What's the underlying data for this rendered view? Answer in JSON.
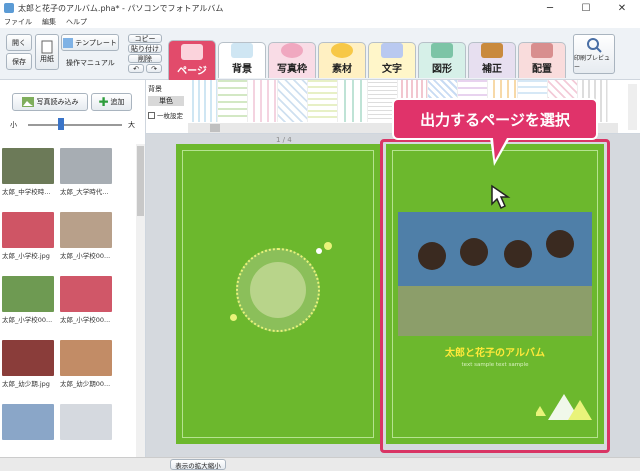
{
  "window": {
    "title": "太郎と花子のアルバム.pha* - パソコンでフォトアルバム",
    "minimize": "─",
    "maximize": "☐",
    "close": "✕"
  },
  "menu": [
    "ファイル",
    "編集",
    "ヘルプ"
  ],
  "toolbar": {
    "open": "開く",
    "save": "保存",
    "paper": "用紙",
    "template": "テンプレート",
    "manual": "操作マニュアル",
    "copy": "コピー",
    "paste": "貼り付け",
    "delete": "削除",
    "undo": "↶",
    "redo": "↷",
    "print_preview": "印刷プレビュー"
  },
  "tabs": [
    {
      "label": "ページ",
      "color": "#e24b6b",
      "active": true
    },
    {
      "label": "背景",
      "color": "#ffffff",
      "active": false
    },
    {
      "label": "写真枠",
      "color": "#f9dce6",
      "active": false
    },
    {
      "label": "素材",
      "color": "#fff0c2",
      "active": false
    },
    {
      "label": "文字",
      "color": "#fff6c9",
      "active": false
    },
    {
      "label": "図形",
      "color": "#d6f0e8",
      "active": false
    },
    {
      "label": "補正",
      "color": "#e7dff0",
      "active": false
    },
    {
      "label": "配置",
      "color": "#f9dcdc",
      "active": false
    }
  ],
  "options": {
    "bg_label": "背景",
    "single_color": "単色",
    "checkbox_label": "一枚設定"
  },
  "left": {
    "load_photos": "写真読み込み",
    "add": "追加",
    "zoom_small": "小",
    "zoom_large": "大",
    "photos": [
      {
        "caption": "太郎_中学校時...",
        "color": "#6c7a58"
      },
      {
        "caption": "太郎_大学時代...",
        "color": "#a7adb3"
      },
      {
        "caption": "太郎_小学校.jpg",
        "color": "#cf5565"
      },
      {
        "caption": "太郎_小学校00...",
        "color": "#b8a08a"
      },
      {
        "caption": "太郎_小学校00...",
        "color": "#6e9a52"
      },
      {
        "caption": "太郎_小学校00...",
        "color": "#d05768"
      },
      {
        "caption": "太郎_幼少期.jpg",
        "color": "#8a3d3a"
      },
      {
        "caption": "太郎_幼少期00...",
        "color": "#c28c66"
      },
      {
        "caption": "",
        "color": "#8aa6c8"
      },
      {
        "caption": "",
        "color": "#d5d9df"
      }
    ]
  },
  "workspace": {
    "page_indicator": "1 / 4",
    "album_title": "太郎と花子のアルバム",
    "album_subtitle": "text sample text sample",
    "callout": "出力するページを選択"
  },
  "status": {
    "zoom_button": "表示の拡大縮小"
  }
}
